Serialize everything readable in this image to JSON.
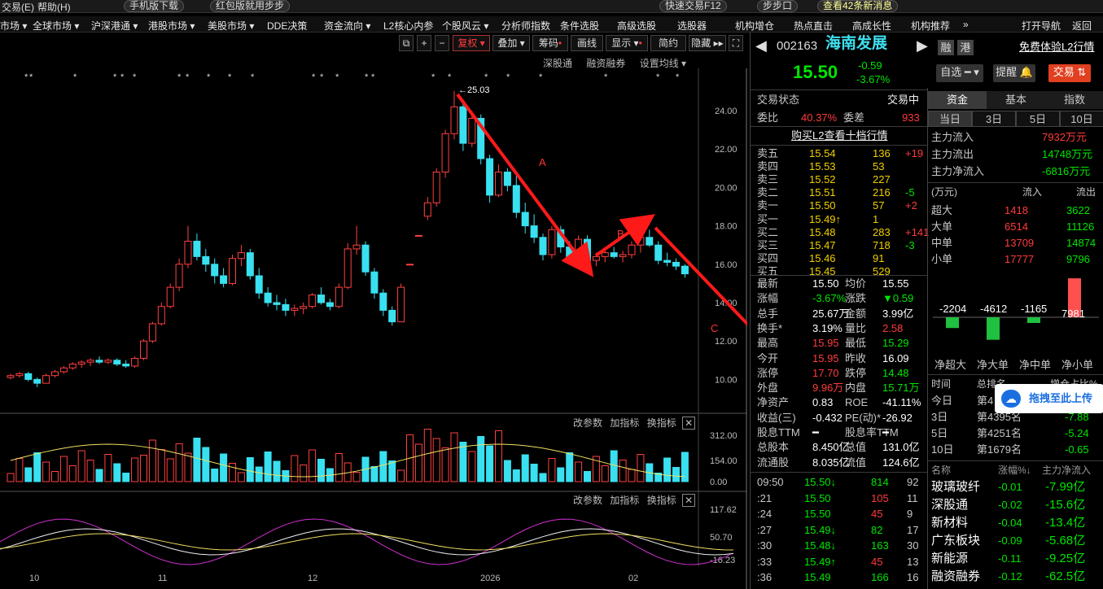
{
  "topbar": {
    "items": [
      "交易(E)",
      "帮助(H)",
      "手机版下载",
      "红包版就用步步",
      "快速交易F12",
      "步步口",
      "查看42条新消息"
    ]
  },
  "menu": [
    "市场 ▾",
    "全球市场 ▾",
    "沪深港通 ▾",
    "港股市场 ▾",
    "美股市场 ▾",
    "DDE决策",
    "资金流向 ▾",
    "L2核心内参",
    "个股风云 ▾",
    "分析师指数",
    "条件选股",
    "高级选股",
    "选股器",
    "机构增仓",
    "热点直击",
    "高成长性",
    "机构推荐",
    "»",
    "打开导航",
    "返回"
  ],
  "toolbar": {
    "fuquan": "复权",
    "diejia": "叠加",
    "chouma": "筹码",
    "huaxian": "画线",
    "xianshi": "显示",
    "jianyue": "简约",
    "yincang": "隐藏"
  },
  "chart_header": {
    "links": [
      "深股通",
      "融资融券",
      "设置均线 ▾"
    ]
  },
  "chart_data": {
    "type": "candlestick",
    "price_axis": [
      "24.00",
      "22.00",
      "20.00",
      "18.00",
      "16.00",
      "14.00",
      "12.00",
      "10.00"
    ],
    "x_axis": [
      "10",
      "11",
      "12",
      "2026",
      "02"
    ],
    "high_label": "←25.03",
    "annotations": [
      "A",
      "B",
      "C"
    ],
    "volume_axis": [
      "312.00",
      "154.00",
      "0.00"
    ],
    "indicator_axis": [
      "117.62",
      "50.70",
      "-16.23"
    ],
    "sub_toolbar": [
      "改参数",
      "加指标",
      "换指标"
    ],
    "candles": [
      [
        10.1,
        10.3,
        10.0,
        10.2
      ],
      [
        10.2,
        10.4,
        10.1,
        10.3
      ],
      [
        10.3,
        10.4,
        9.9,
        10.0
      ],
      [
        10.0,
        10.1,
        9.6,
        9.8
      ],
      [
        9.8,
        10.3,
        9.8,
        10.2
      ],
      [
        10.2,
        10.5,
        10.1,
        10.4
      ],
      [
        10.4,
        10.7,
        10.3,
        10.6
      ],
      [
        10.6,
        10.9,
        10.5,
        10.8
      ],
      [
        10.8,
        11.0,
        10.6,
        10.9
      ],
      [
        10.9,
        11.1,
        10.7,
        11.0
      ],
      [
        11.0,
        11.2,
        10.8,
        10.9
      ],
      [
        10.9,
        11.1,
        10.8,
        11.0
      ],
      [
        11.0,
        11.1,
        10.7,
        10.8
      ],
      [
        10.8,
        11.0,
        10.6,
        10.7
      ],
      [
        10.7,
        11.2,
        10.6,
        11.1
      ],
      [
        11.1,
        12.1,
        11.0,
        12.0
      ],
      [
        12.0,
        13.0,
        11.9,
        12.9
      ],
      [
        12.9,
        14.0,
        12.8,
        13.8
      ],
      [
        13.8,
        15.0,
        13.7,
        14.8
      ],
      [
        14.8,
        16.3,
        14.6,
        16.0
      ],
      [
        16.0,
        18.0,
        15.8,
        17.2
      ],
      [
        17.2,
        17.6,
        16.2,
        16.4
      ],
      [
        16.4,
        16.8,
        15.6,
        16.0
      ],
      [
        16.0,
        16.3,
        15.0,
        15.4
      ],
      [
        15.4,
        15.8,
        14.8,
        15.0
      ],
      [
        15.0,
        16.5,
        14.9,
        16.3
      ],
      [
        16.3,
        17.0,
        15.9,
        16.6
      ],
      [
        16.6,
        16.8,
        15.2,
        15.4
      ],
      [
        15.4,
        15.8,
        14.2,
        14.5
      ],
      [
        14.5,
        14.8,
        13.8,
        14.0
      ],
      [
        14.0,
        14.4,
        13.6,
        13.9
      ],
      [
        13.9,
        14.2,
        13.3,
        13.6
      ],
      [
        13.6,
        13.9,
        13.3,
        13.7
      ],
      [
        13.7,
        14.0,
        13.4,
        13.8
      ],
      [
        13.8,
        14.5,
        13.7,
        14.4
      ],
      [
        14.4,
        14.8,
        13.9,
        14.0
      ],
      [
        14.0,
        14.2,
        13.6,
        13.8
      ],
      [
        13.8,
        15.0,
        13.7,
        14.8
      ],
      [
        14.8,
        17.1,
        14.7,
        16.8
      ],
      [
        16.8,
        18.0,
        16.5,
        17.0
      ],
      [
        17.0,
        17.2,
        15.4,
        15.6
      ],
      [
        15.6,
        15.8,
        14.2,
        14.5
      ],
      [
        14.5,
        14.7,
        13.3,
        13.6
      ],
      [
        13.6,
        13.8,
        12.8,
        13.0
      ],
      [
        13.0,
        15.0,
        13.0,
        14.8
      ],
      [
        16.0,
        16.0,
        16.0,
        16.0
      ],
      [
        17.5,
        17.5,
        17.5,
        17.5
      ],
      [
        18.5,
        19.5,
        18.3,
        19.2
      ],
      [
        19.2,
        21.0,
        19.0,
        20.8
      ],
      [
        20.8,
        23.0,
        20.5,
        22.8
      ],
      [
        22.8,
        25.03,
        22.5,
        24.2
      ],
      [
        24.2,
        24.5,
        21.9,
        22.3
      ],
      [
        22.3,
        24.0,
        22.1,
        23.6
      ],
      [
        23.6,
        23.8,
        21.2,
        21.5
      ],
      [
        21.5,
        21.7,
        19.2,
        19.6
      ],
      [
        19.6,
        21.2,
        19.5,
        20.8
      ],
      [
        20.8,
        21.0,
        19.8,
        20.1
      ],
      [
        20.1,
        20.6,
        18.4,
        18.7
      ],
      [
        18.7,
        19.2,
        17.6,
        18.0
      ],
      [
        18.0,
        18.6,
        17.1,
        17.4
      ],
      [
        17.4,
        17.6,
        16.2,
        16.5
      ],
      [
        16.5,
        18.0,
        16.3,
        17.8
      ],
      [
        17.8,
        18.0,
        16.6,
        16.9
      ],
      [
        16.9,
        17.2,
        16.1,
        16.4
      ],
      [
        16.4,
        17.5,
        16.3,
        17.3
      ],
      [
        17.3,
        17.5,
        16.0,
        16.2
      ],
      [
        16.2,
        16.6,
        15.9,
        16.4
      ],
      [
        16.4,
        16.8,
        16.1,
        16.6
      ],
      [
        16.6,
        16.9,
        16.3,
        16.4
      ],
      [
        16.4,
        16.7,
        16.1,
        16.5
      ],
      [
        16.5,
        17.2,
        16.3,
        17.0
      ],
      [
        17.0,
        17.6,
        16.6,
        17.4
      ],
      [
        17.4,
        17.8,
        16.9,
        17.0
      ],
      [
        17.0,
        17.2,
        16.0,
        16.2
      ],
      [
        16.2,
        16.6,
        15.9,
        16.1
      ],
      [
        16.1,
        16.3,
        15.7,
        15.9
      ],
      [
        15.9,
        16.0,
        15.3,
        15.5
      ]
    ]
  },
  "quote": {
    "code": "002163",
    "name": "海南发展",
    "rz": "融",
    "hk": "港",
    "l2": "免费体验L2行情",
    "price": "15.50",
    "change": "-0.59",
    "pct": "-3.67%",
    "zixuan": "自选 ━ ▾",
    "tixing": "提醒 🔔",
    "jiaoyi": "交易 ⇅"
  },
  "status": {
    "label": "交易状态",
    "value": "交易中",
    "weibi_label": "委比",
    "weibi": "40.37%",
    "weicha_label": "委差",
    "weicha": "933",
    "buy_l2": "购买L2查看十档行情"
  },
  "asks": [
    {
      "label": "卖五",
      "price": "15.54",
      "vol": "136",
      "chg": "+19"
    },
    {
      "label": "卖四",
      "price": "15.53",
      "vol": "53",
      "chg": ""
    },
    {
      "label": "卖三",
      "price": "15.52",
      "vol": "227",
      "chg": ""
    },
    {
      "label": "卖二",
      "price": "15.51",
      "vol": "216",
      "chg": "-5"
    },
    {
      "label": "卖一",
      "price": "15.50",
      "vol": "57",
      "chg": "+2"
    }
  ],
  "bids": [
    {
      "label": "买一",
      "price": "15.49↑",
      "vol": "1",
      "chg": ""
    },
    {
      "label": "买二",
      "price": "15.48",
      "vol": "283",
      "chg": "+141"
    },
    {
      "label": "买三",
      "price": "15.47",
      "vol": "718",
      "chg": "-3"
    },
    {
      "label": "买四",
      "price": "15.46",
      "vol": "91",
      "chg": ""
    },
    {
      "label": "买五",
      "price": "15.45",
      "vol": "529",
      "chg": ""
    }
  ],
  "stats": [
    [
      "最新",
      "15.50",
      "均价",
      "15.55"
    ],
    [
      "涨幅",
      "-3.67%",
      "涨跌",
      "▼0.59"
    ],
    [
      "总手",
      "25.67万",
      "金额",
      "3.99亿"
    ],
    [
      "换手*",
      "3.19%",
      "量比",
      "2.58"
    ],
    [
      "最高",
      "15.95",
      "最低",
      "15.29"
    ],
    [
      "今开",
      "15.95",
      "昨收",
      "16.09"
    ],
    [
      "涨停",
      "17.70",
      "跌停",
      "14.48"
    ],
    [
      "外盘",
      "9.96万",
      "内盘",
      "15.71万"
    ],
    [
      "净资产",
      "0.83",
      "ROE",
      "-41.11%"
    ],
    [
      "收益(三)",
      "-0.432",
      "PE(动)*",
      "-26.92"
    ],
    [
      "股息TTM",
      "━",
      "股息率TTM",
      "━"
    ],
    [
      "总股本",
      "8.450亿",
      "总值",
      "131.0亿"
    ],
    [
      "流通股",
      "8.035亿",
      "流值",
      "124.6亿"
    ]
  ],
  "ticks": [
    [
      "09:50",
      "15.50↓",
      "814",
      "92"
    ],
    [
      ":21",
      "15.50",
      "105",
      "11"
    ],
    [
      ":24",
      "15.50",
      "45",
      "9"
    ],
    [
      ":27",
      "15.49↓",
      "82",
      "17"
    ],
    [
      ":30",
      "15.48↓",
      "163",
      "30"
    ],
    [
      ":33",
      "15.49↑",
      "45",
      "13"
    ],
    [
      ":36",
      "15.49",
      "166",
      "16"
    ]
  ],
  "fund": {
    "tabs": [
      "资金",
      "基本",
      "指数"
    ],
    "periods": [
      "当日",
      "3日",
      "5日",
      "10日"
    ],
    "flows": [
      [
        "主力流入",
        "7932万元"
      ],
      [
        "主力流出",
        "14748万元"
      ],
      [
        "主力净流入",
        "-6816万元"
      ]
    ],
    "head": [
      "(万元)",
      "流入",
      "流出"
    ],
    "rows": [
      [
        "超大",
        "1418",
        "3622"
      ],
      [
        "大单",
        "6514",
        "11126"
      ],
      [
        "中单",
        "13709",
        "14874"
      ],
      [
        "小单",
        "17777",
        "9796"
      ]
    ],
    "bars": [
      {
        "label": "-2204",
        "value": -2204
      },
      {
        "label": "-4612",
        "value": -4612
      },
      {
        "label": "-1165",
        "value": -1165
      },
      {
        "label": "7981",
        "value": 7981
      }
    ],
    "bar_names": [
      "净超大",
      "净大单",
      "净中单",
      "净小单"
    ],
    "rank_head": [
      "时间",
      "总排名",
      "增仓占比%"
    ],
    "rank": [
      [
        "今日",
        "第4",
        "-3.47"
      ],
      [
        "3日",
        "第4395名",
        "-7.88"
      ],
      [
        "5日",
        "第4251名",
        "-5.24"
      ],
      [
        "10日",
        "第1679名",
        "-0.65"
      ]
    ],
    "upload": "拖拽至此上传",
    "sector_head": [
      "名称",
      "涨幅%↓",
      "主力净流入"
    ],
    "sectors": [
      [
        "玻璃玻纤",
        "-0.01",
        "-7.99亿"
      ],
      [
        "深股通",
        "-0.02",
        "-15.6亿"
      ],
      [
        "新材料",
        "-0.04",
        "-13.4亿"
      ],
      [
        "广东板块",
        "-0.09",
        "-5.68亿"
      ],
      [
        "新能源",
        "-0.11",
        "-9.25亿"
      ],
      [
        "融资融券",
        "-0.12",
        "-62.5亿"
      ]
    ]
  }
}
